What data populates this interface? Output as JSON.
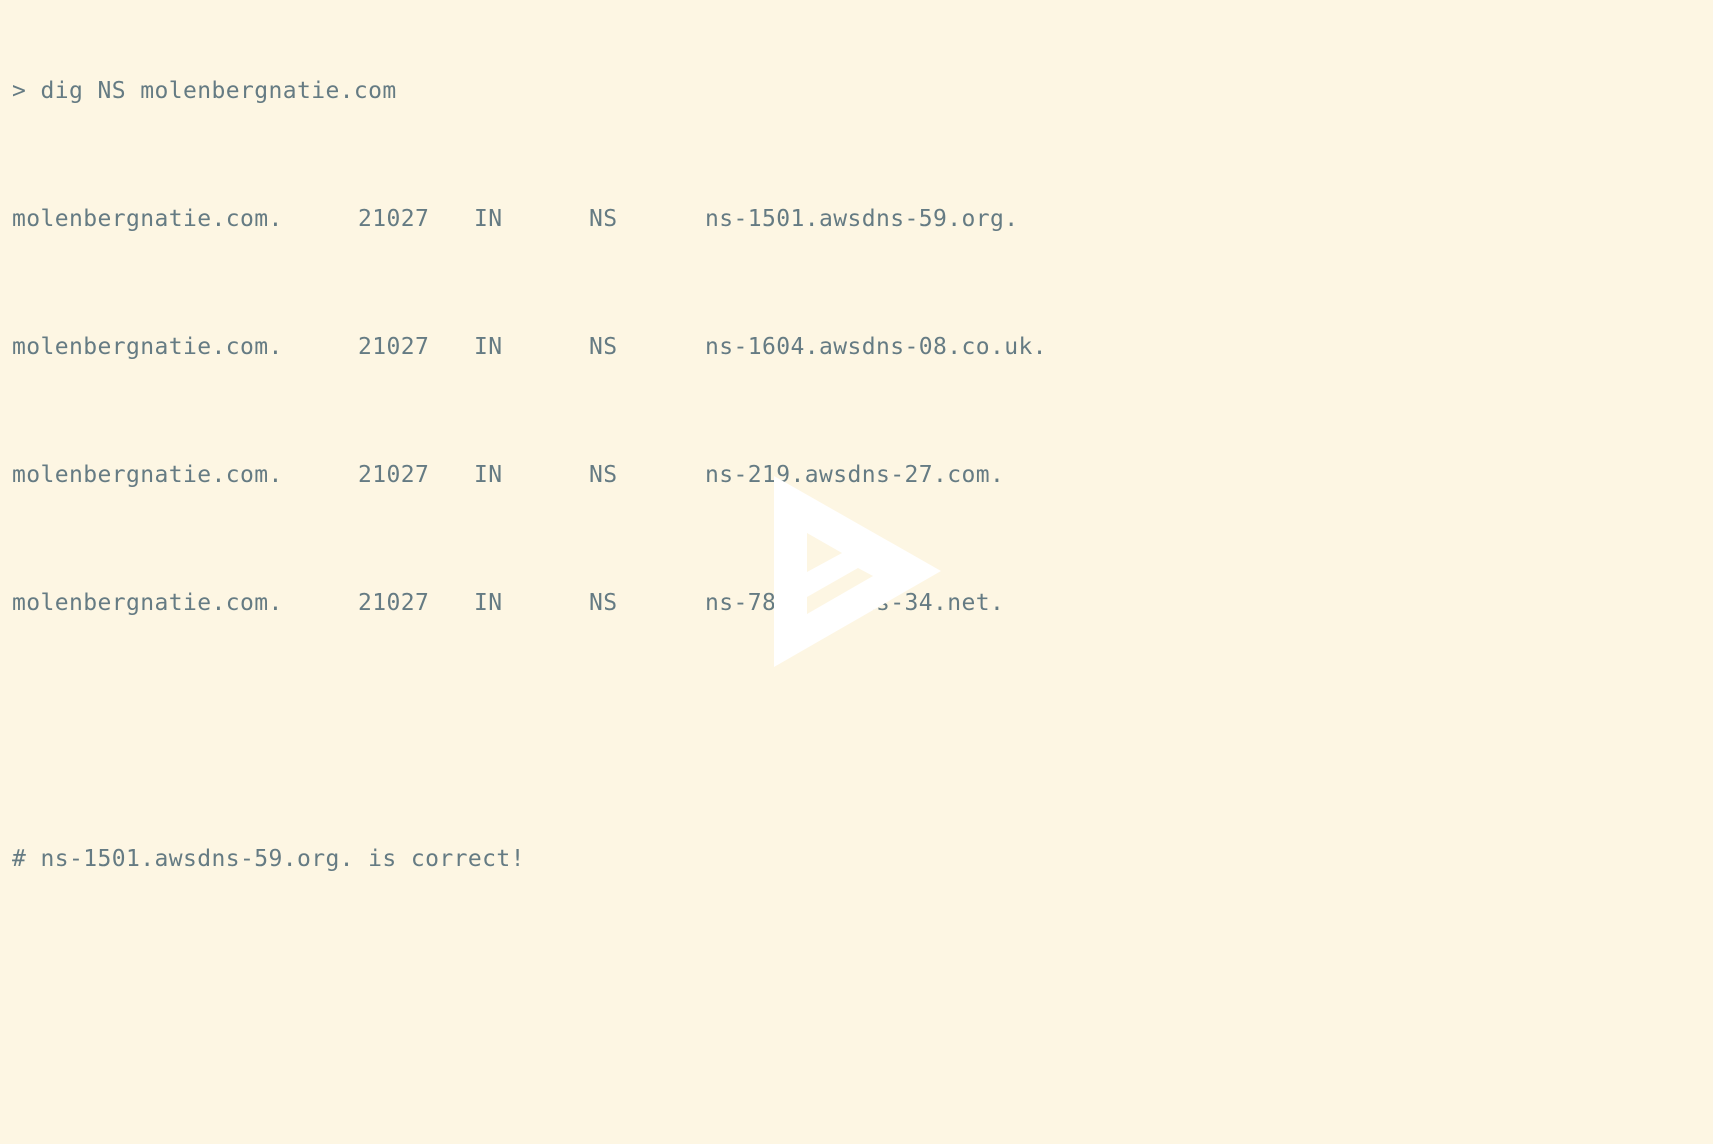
{
  "terminal": {
    "command_line": "> dig NS molenbergnatie.com",
    "records": [
      {
        "name": "molenbergnatie.com.",
        "ttl": "21027",
        "class": "IN",
        "type": "NS",
        "value": "ns-1501.awsdns-59.org."
      },
      {
        "name": "molenbergnatie.com.",
        "ttl": "21027",
        "class": "IN",
        "type": "NS",
        "value": "ns-1604.awsdns-08.co.uk."
      },
      {
        "name": "molenbergnatie.com.",
        "ttl": "21027",
        "class": "IN",
        "type": "NS",
        "value": "ns-219.awsdns-27.com."
      },
      {
        "name": "molenbergnatie.com.",
        "ttl": "21027",
        "class": "IN",
        "type": "NS",
        "value": "ns-787.awsdns-34.net."
      }
    ],
    "comment_line": "# ns-1501.awsdns-59.org. is correct!"
  },
  "overlay": {
    "icon": "play-icon"
  },
  "colors": {
    "background": "#fdf6e3",
    "text": "#657b83",
    "play_icon": "#ffffff"
  }
}
